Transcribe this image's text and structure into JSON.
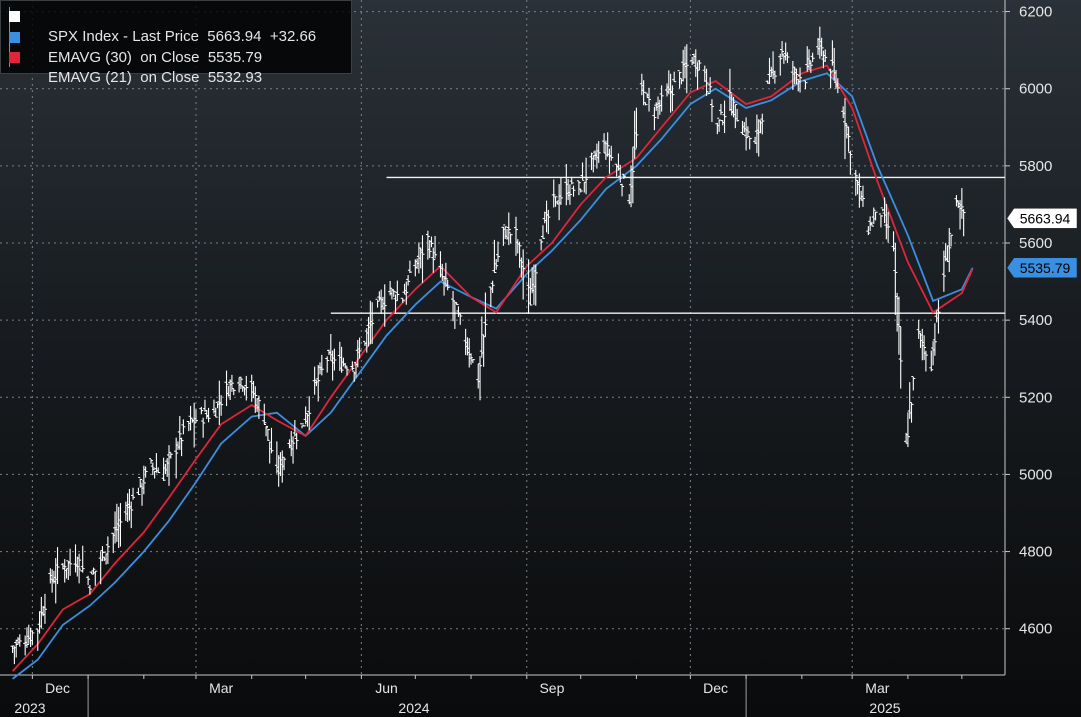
{
  "legend": {
    "last_price": {
      "label": "SPX Index - Last Price",
      "value": "5663.94",
      "change": "+32.66",
      "color": "#ffffff"
    },
    "ema30": {
      "label": "EMAVG (30)  on Close",
      "value": "5535.79",
      "color": "#3a8fe0"
    },
    "ema21": {
      "label": "EMAVG (21)  on Close",
      "value": "5532.93",
      "color": "#e0253a"
    }
  },
  "price_tags": [
    {
      "value": "5663.94",
      "bg": "#ffffff",
      "fg": "#000000"
    },
    {
      "value": "5535.79",
      "bg": "#3a8fe0",
      "fg": "#000000"
    }
  ],
  "chart_data": {
    "type": "line",
    "y_axis": {
      "position": "right",
      "ticks": [
        4600,
        4800,
        5000,
        5200,
        5400,
        5600,
        5800,
        6000,
        6200
      ],
      "ylim": [
        4480,
        6230
      ]
    },
    "x_axis": {
      "month_labels": [
        "Dec",
        "Mar",
        "Jun",
        "Sep",
        "Dec",
        "Mar"
      ],
      "year_labels": [
        "2023",
        "2024",
        "2025"
      ]
    },
    "grid": true,
    "horizontal_lines": [
      {
        "value": 5770,
        "start": "2024-06-15"
      },
      {
        "value": 5418,
        "start": "2024-05-15"
      }
    ],
    "series": [
      {
        "name": "SPX Index - Last Price",
        "style": "ohlc-bars",
        "color": "#ffffff",
        "points": [
          [
            "2023-11-20",
            4550
          ],
          [
            "2023-11-27",
            4570
          ],
          [
            "2023-12-04",
            4600
          ],
          [
            "2023-12-11",
            4720
          ],
          [
            "2023-12-18",
            4760
          ],
          [
            "2023-12-26",
            4780
          ],
          [
            "2024-01-02",
            4720
          ],
          [
            "2024-01-08",
            4780
          ],
          [
            "2024-01-16",
            4850
          ],
          [
            "2024-01-22",
            4900
          ],
          [
            "2024-01-29",
            4960
          ],
          [
            "2024-02-05",
            5020
          ],
          [
            "2024-02-12",
            5000
          ],
          [
            "2024-02-20",
            5080
          ],
          [
            "2024-02-26",
            5130
          ],
          [
            "2024-03-04",
            5150
          ],
          [
            "2024-03-11",
            5160
          ],
          [
            "2024-03-18",
            5220
          ],
          [
            "2024-03-25",
            5250
          ],
          [
            "2024-04-01",
            5220
          ],
          [
            "2024-04-08",
            5150
          ],
          [
            "2024-04-15",
            5000
          ],
          [
            "2024-04-22",
            5080
          ],
          [
            "2024-04-29",
            5120
          ],
          [
            "2024-05-06",
            5220
          ],
          [
            "2024-05-13",
            5300
          ],
          [
            "2024-05-20",
            5290
          ],
          [
            "2024-05-28",
            5280
          ],
          [
            "2024-06-03",
            5350
          ],
          [
            "2024-06-10",
            5430
          ],
          [
            "2024-06-17",
            5470
          ],
          [
            "2024-06-24",
            5460
          ],
          [
            "2024-07-01",
            5540
          ],
          [
            "2024-07-08",
            5610
          ],
          [
            "2024-07-15",
            5520
          ],
          [
            "2024-07-22",
            5450
          ],
          [
            "2024-07-29",
            5350
          ],
          [
            "2024-08-05",
            5250
          ],
          [
            "2024-08-12",
            5480
          ],
          [
            "2024-08-19",
            5630
          ],
          [
            "2024-08-26",
            5620
          ],
          [
            "2024-09-03",
            5450
          ],
          [
            "2024-09-09",
            5620
          ],
          [
            "2024-09-16",
            5700
          ],
          [
            "2024-09-23",
            5740
          ],
          [
            "2024-09-30",
            5740
          ],
          [
            "2024-10-07",
            5800
          ],
          [
            "2024-10-14",
            5850
          ],
          [
            "2024-10-21",
            5800
          ],
          [
            "2024-10-28",
            5720
          ],
          [
            "2024-11-04",
            5990
          ],
          [
            "2024-11-11",
            5940
          ],
          [
            "2024-11-18",
            5980
          ],
          [
            "2024-11-25",
            6030
          ],
          [
            "2024-12-02",
            6080
          ],
          [
            "2024-12-09",
            6050
          ],
          [
            "2024-12-16",
            5900
          ],
          [
            "2024-12-23",
            5970
          ],
          [
            "2024-12-30",
            5900
          ],
          [
            "2025-01-06",
            5850
          ],
          [
            "2025-01-13",
            6000
          ],
          [
            "2025-01-21",
            6100
          ],
          [
            "2025-01-27",
            6040
          ],
          [
            "2025-02-03",
            6030
          ],
          [
            "2025-02-10",
            6110
          ],
          [
            "2025-02-18",
            6050
          ],
          [
            "2025-02-24",
            5950
          ],
          [
            "2025-03-03",
            5770
          ],
          [
            "2025-03-10",
            5640
          ],
          [
            "2025-03-17",
            5680
          ],
          [
            "2025-03-24",
            5590
          ],
          [
            "2025-03-31",
            5070
          ],
          [
            "2025-04-07",
            5360
          ],
          [
            "2025-04-14",
            5290
          ],
          [
            "2025-04-21",
            5520
          ],
          [
            "2025-04-28",
            5690
          ],
          [
            "2025-05-05",
            5663.94
          ]
        ]
      },
      {
        "name": "EMAVG (30)  on Close",
        "style": "line",
        "color": "#3a8fe0",
        "points": [
          [
            "2023-11-20",
            4470
          ],
          [
            "2023-12-04",
            4520
          ],
          [
            "2023-12-18",
            4610
          ],
          [
            "2024-01-02",
            4660
          ],
          [
            "2024-01-16",
            4720
          ],
          [
            "2024-02-01",
            4800
          ],
          [
            "2024-02-15",
            4880
          ],
          [
            "2024-03-01",
            4980
          ],
          [
            "2024-03-15",
            5080
          ],
          [
            "2024-04-01",
            5150
          ],
          [
            "2024-04-15",
            5160
          ],
          [
            "2024-05-01",
            5100
          ],
          [
            "2024-05-15",
            5160
          ],
          [
            "2024-06-01",
            5270
          ],
          [
            "2024-06-15",
            5360
          ],
          [
            "2024-07-01",
            5440
          ],
          [
            "2024-07-15",
            5500
          ],
          [
            "2024-08-01",
            5460
          ],
          [
            "2024-08-15",
            5430
          ],
          [
            "2024-09-01",
            5520
          ],
          [
            "2024-09-15",
            5580
          ],
          [
            "2024-10-01",
            5660
          ],
          [
            "2024-10-15",
            5740
          ],
          [
            "2024-11-01",
            5800
          ],
          [
            "2024-11-15",
            5870
          ],
          [
            "2024-12-01",
            5960
          ],
          [
            "2024-12-15",
            6000
          ],
          [
            "2025-01-01",
            5950
          ],
          [
            "2025-01-15",
            5970
          ],
          [
            "2025-02-01",
            6020
          ],
          [
            "2025-02-15",
            6040
          ],
          [
            "2025-03-01",
            5980
          ],
          [
            "2025-03-15",
            5800
          ],
          [
            "2025-04-01",
            5620
          ],
          [
            "2025-04-15",
            5450
          ],
          [
            "2025-05-01",
            5480
          ],
          [
            "2025-05-07",
            5535.79
          ]
        ]
      },
      {
        "name": "EMAVG (21)  on Close",
        "style": "line",
        "color": "#e0253a",
        "points": [
          [
            "2023-11-20",
            4490
          ],
          [
            "2023-12-04",
            4560
          ],
          [
            "2023-12-18",
            4650
          ],
          [
            "2024-01-02",
            4690
          ],
          [
            "2024-01-16",
            4770
          ],
          [
            "2024-02-01",
            4850
          ],
          [
            "2024-02-15",
            4940
          ],
          [
            "2024-03-01",
            5040
          ],
          [
            "2024-03-15",
            5130
          ],
          [
            "2024-04-01",
            5180
          ],
          [
            "2024-04-15",
            5140
          ],
          [
            "2024-05-01",
            5100
          ],
          [
            "2024-05-15",
            5200
          ],
          [
            "2024-06-01",
            5310
          ],
          [
            "2024-06-15",
            5400
          ],
          [
            "2024-07-01",
            5480
          ],
          [
            "2024-07-15",
            5540
          ],
          [
            "2024-08-01",
            5460
          ],
          [
            "2024-08-15",
            5420
          ],
          [
            "2024-09-01",
            5540
          ],
          [
            "2024-09-15",
            5600
          ],
          [
            "2024-10-01",
            5700
          ],
          [
            "2024-10-15",
            5770
          ],
          [
            "2024-11-01",
            5820
          ],
          [
            "2024-11-15",
            5900
          ],
          [
            "2024-12-01",
            5990
          ],
          [
            "2024-12-15",
            6020
          ],
          [
            "2025-01-01",
            5960
          ],
          [
            "2025-01-15",
            5980
          ],
          [
            "2025-02-01",
            6040
          ],
          [
            "2025-02-15",
            6060
          ],
          [
            "2025-03-01",
            5950
          ],
          [
            "2025-03-15",
            5760
          ],
          [
            "2025-04-01",
            5550
          ],
          [
            "2025-04-15",
            5420
          ],
          [
            "2025-05-01",
            5470
          ],
          [
            "2025-05-07",
            5532.93
          ]
        ]
      }
    ]
  }
}
